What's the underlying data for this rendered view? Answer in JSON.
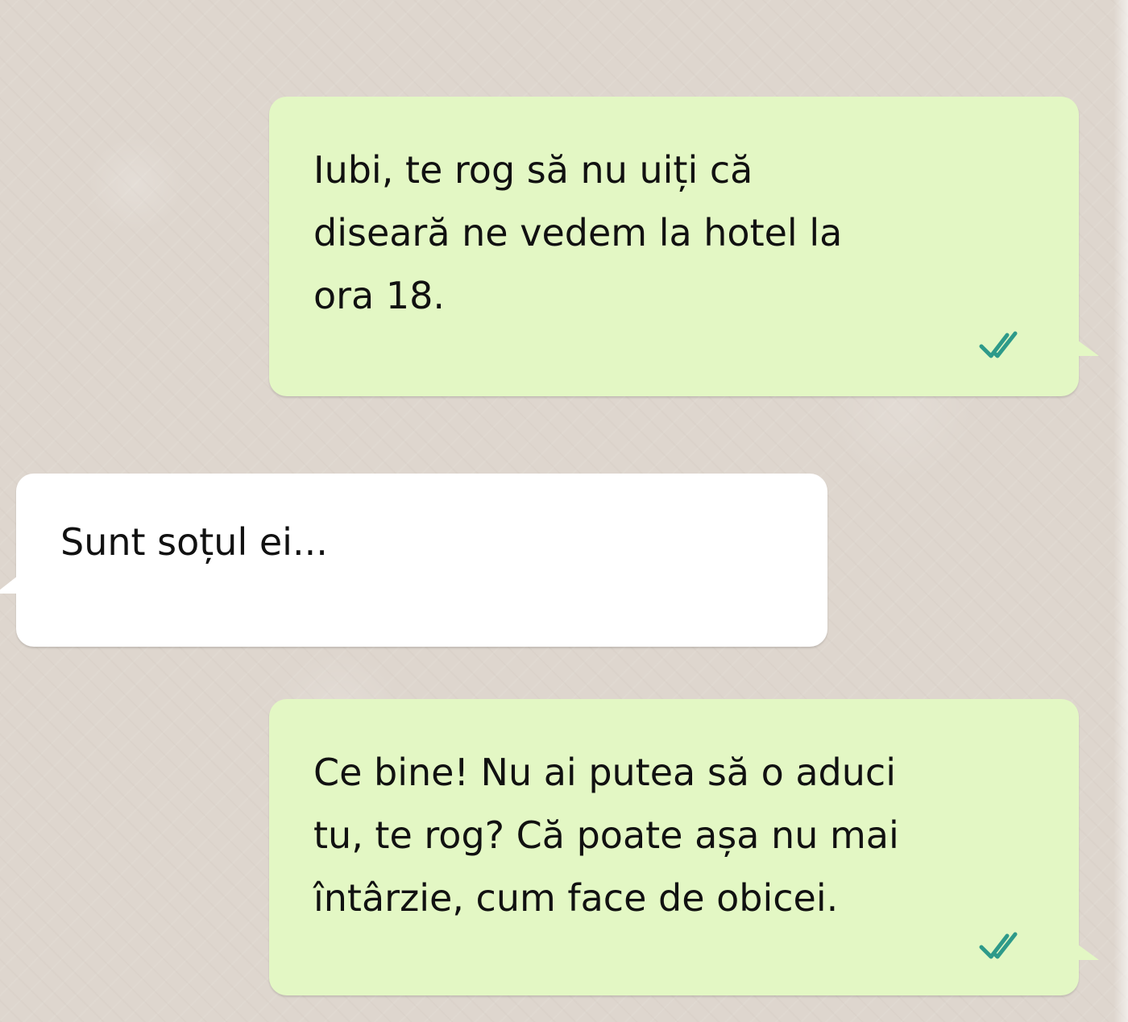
{
  "chat": {
    "messages": [
      {
        "direction": "outgoing",
        "text": "Iubi, te rog să nu uiți că\ndiseară ne vedem la hotel la\nora 18.",
        "status_icon": "double-check-icon"
      },
      {
        "direction": "incoming",
        "text": "Sunt soțul ei..."
      },
      {
        "direction": "outgoing",
        "text": "Ce bine! Nu ai putea să o aduci\ntu, te rog? Că poate așa nu mai\nîntârzie, cum face de obicei.",
        "status_icon": "double-check-icon"
      }
    ]
  },
  "colors": {
    "outgoing_bubble": "#e3f7c4",
    "incoming_bubble": "#ffffff",
    "read_check": "#2e9a8a",
    "wallpaper": "#ded6ce"
  }
}
